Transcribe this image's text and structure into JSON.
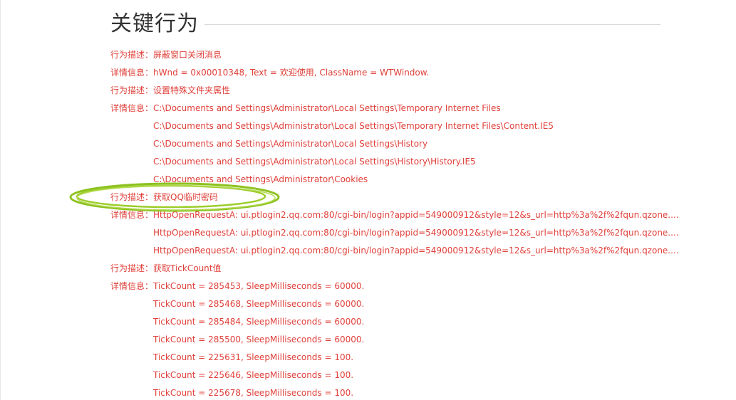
{
  "section": {
    "title": "关键行为"
  },
  "accent_color": "#e0403a",
  "highlight_color": "#8dc21f",
  "rows": [
    {
      "label": "行为描述：",
      "value": "屏蔽窗口关闭消息"
    },
    {
      "label": "详情信息：",
      "value": "hWnd = 0x00010348, Text = 欢迎使用, ClassName = WTWindow."
    },
    {
      "label": "行为描述：",
      "value": "设置特殊文件夹属性"
    },
    {
      "label": "详情信息：",
      "value": "C:\\Documents and Settings\\Administrator\\Local Settings\\Temporary Internet Files"
    },
    {
      "label": "",
      "value": "C:\\Documents and Settings\\Administrator\\Local Settings\\Temporary Internet Files\\Content.IE5"
    },
    {
      "label": "",
      "value": "C:\\Documents and Settings\\Administrator\\Local Settings\\History"
    },
    {
      "label": "",
      "value": "C:\\Documents and Settings\\Administrator\\Local Settings\\History\\History.IE5"
    },
    {
      "label": "",
      "value": "C:\\Documents and Settings\\Administrator\\Cookies"
    },
    {
      "label": "行为描述：",
      "value": "获取QQ临时密码"
    },
    {
      "label": "详情信息：",
      "value": "HttpOpenRequestA: ui.ptlogin2.qq.com:80/cgi-bin/login?appid=549000912&style=12&s_url=http%3a%2f%2fqun.qzone...."
    },
    {
      "label": "",
      "value": "HttpOpenRequestA: ui.ptlogin2.qq.com:80/cgi-bin/login?appid=549000912&style=12&s_url=http%3a%2f%2fqun.qzone...."
    },
    {
      "label": "",
      "value": "HttpOpenRequestA: ui.ptlogin2.qq.com:80/cgi-bin/login?appid=549000912&style=12&s_url=http%3a%2f%2fqun.qzone...."
    },
    {
      "label": "行为描述：",
      "value": "获取TickCount值"
    },
    {
      "label": "详情信息：",
      "value": "TickCount = 285453, SleepMilliseconds = 60000."
    },
    {
      "label": "",
      "value": "TickCount = 285468, SleepMilliseconds = 60000."
    },
    {
      "label": "",
      "value": "TickCount = 285484, SleepMilliseconds = 60000."
    },
    {
      "label": "",
      "value": "TickCount = 285500, SleepMilliseconds = 60000."
    },
    {
      "label": "",
      "value": "TickCount = 225631, SleepMilliseconds = 100."
    },
    {
      "label": "",
      "value": "TickCount = 225646, SleepMilliseconds = 100."
    },
    {
      "label": "",
      "value": "TickCount = 225678, SleepMilliseconds = 100."
    }
  ]
}
